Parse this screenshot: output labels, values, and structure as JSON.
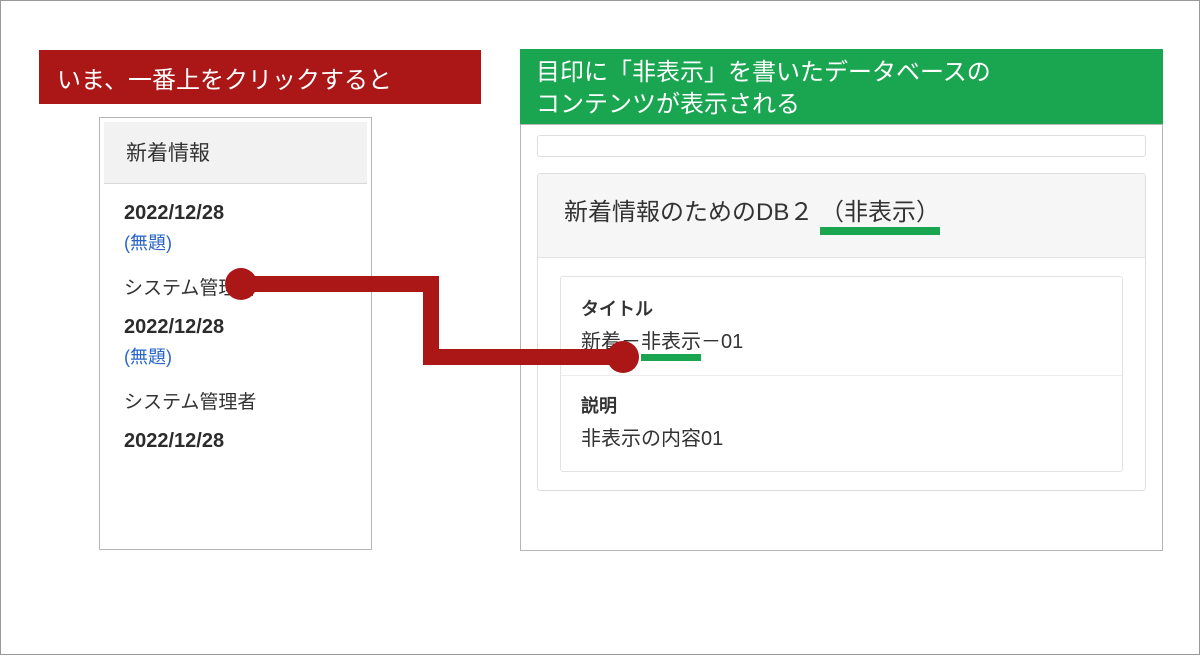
{
  "red_banner": {
    "text": "いま、一番上をクリックすると"
  },
  "list": {
    "header": "新着情報",
    "items": [
      {
        "date": "2022/12/28",
        "title": "(無題)",
        "author": "システム管理者"
      },
      {
        "date": "2022/12/28",
        "title": "(無題)",
        "author": "システム管理者"
      },
      {
        "date": "2022/12/28",
        "title": "",
        "author": ""
      }
    ]
  },
  "green_banner": {
    "line1": "目印に「非表示」を書いたデータベースの",
    "line2": "コンテンツが表示される"
  },
  "right": {
    "header_prefix": "新着情報のためのDB２ ",
    "header_highlight": "（非表示）",
    "field1_label": "タイトル",
    "field1_value_prefix": "新着－",
    "field1_value_highlight": "非表示",
    "field1_value_suffix": "－01",
    "field2_label": "説明",
    "field2_value": "非表示の内容01"
  }
}
